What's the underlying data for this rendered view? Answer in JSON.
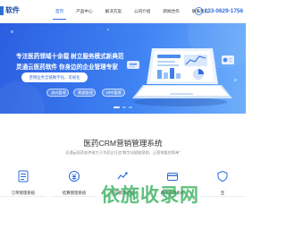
{
  "header": {
    "brand": "软件",
    "nav": [
      "首页",
      "产品中心",
      "解决方案",
      "公司介绍",
      "新闻合作",
      "联系我们"
    ],
    "active_index": 0,
    "phone": "133-0629-1756"
  },
  "hero": {
    "headline_1": "专注医药领域十余载 树立服务模式新典范",
    "headline_2": "灵通云医药软件 你身边的企业管理专家",
    "subtitle": "营销业务全链数字化、可视化",
    "pills": [
      "流向管理",
      "票据管理",
      "SFE管理"
    ],
    "slides": 3,
    "active_slide": 0
  },
  "section": {
    "title": "医药CRM营销管理系统",
    "subtitle": "灵通云医药软件致力于为药企打造“数字化赋能营销，让营销管控简单”"
  },
  "features": [
    {
      "label": "订单管理系统"
    },
    {
      "label": "结算管理系统"
    },
    {
      "label": "流向管理系统"
    },
    {
      "label": "费用管理系统"
    },
    {
      "label": "宝"
    }
  ],
  "watermark": "依施收录网",
  "colors": {
    "accent": "#2c6be0",
    "hero_start": "#2b5fe0",
    "hero_end": "#6fb0fb",
    "watermark": "#28aa50"
  }
}
